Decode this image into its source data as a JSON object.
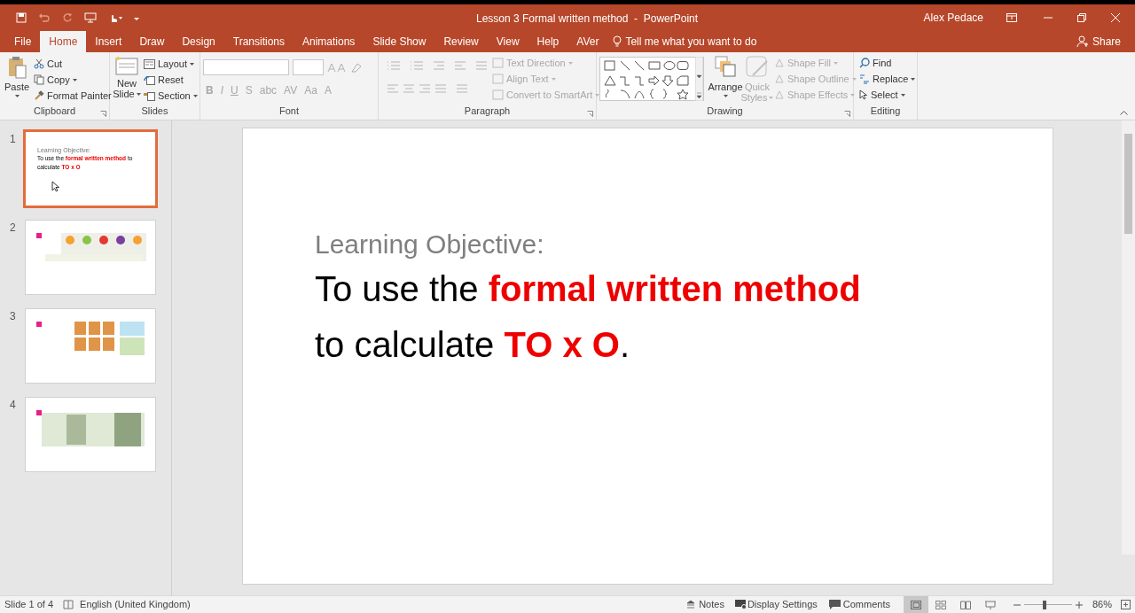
{
  "window": {
    "title": "Lesson 3 Formal written method  -  PowerPoint",
    "user": "Alex Pedace"
  },
  "tabs": [
    {
      "label": "File",
      "selected": false
    },
    {
      "label": "Home",
      "selected": true
    },
    {
      "label": "Insert",
      "selected": false
    },
    {
      "label": "Draw",
      "selected": false
    },
    {
      "label": "Design",
      "selected": false
    },
    {
      "label": "Transitions",
      "selected": false
    },
    {
      "label": "Animations",
      "selected": false
    },
    {
      "label": "Slide Show",
      "selected": false
    },
    {
      "label": "Review",
      "selected": false
    },
    {
      "label": "View",
      "selected": false
    },
    {
      "label": "Help",
      "selected": false
    },
    {
      "label": "AVer",
      "selected": false
    }
  ],
  "tell_me": {
    "placeholder": "Tell me what you want to do"
  },
  "share": "Share",
  "ribbon": {
    "clipboard": {
      "label": "Clipboard",
      "paste": "Paste",
      "cut": "Cut",
      "copy": "Copy",
      "format_painter": "Format Painter"
    },
    "slides": {
      "label": "Slides",
      "new_slide": [
        "New",
        "Slide"
      ],
      "layout": "Layout",
      "reset": "Reset",
      "section": "Section"
    },
    "font": {
      "label": "Font",
      "buttons": [
        {
          "text": "B",
          "disabled": true
        },
        {
          "text": "I",
          "disabled": true
        },
        {
          "text": "U",
          "disabled": true
        },
        {
          "text": "S",
          "disabled": true
        },
        {
          "text": "abc",
          "disabled": true
        },
        {
          "text": "AV",
          "disabled": true
        },
        {
          "text": "Aa",
          "disabled": true
        },
        {
          "text": "A",
          "disabled": true
        }
      ]
    },
    "paragraph": {
      "label": "Paragraph",
      "items": [
        {
          "label": "Text Direction",
          "disabled": true
        },
        {
          "label": "Align Text",
          "disabled": true
        },
        {
          "label": "Convert to SmartArt",
          "disabled": true
        }
      ]
    },
    "drawing": {
      "label": "Drawing",
      "arrange": "Arrange",
      "quick_styles": [
        "Quick",
        "Styles"
      ],
      "quick_styles_disabled": true,
      "items": [
        {
          "label": "Shape Fill",
          "disabled": true
        },
        {
          "label": "Shape Outline",
          "disabled": true
        },
        {
          "label": "Shape Effects",
          "disabled": true
        }
      ]
    },
    "editing": {
      "label": "Editing",
      "find": "Find",
      "replace": "Replace",
      "select": "Select"
    }
  },
  "thumbnails": [
    {
      "number": "1",
      "selected": true,
      "kind": "title",
      "heading": "Learning Objective:",
      "body": "To use the **formal written method** to calculate **TO x O**"
    },
    {
      "number": "2",
      "selected": false,
      "kind": "picture"
    },
    {
      "number": "3",
      "selected": false,
      "kind": "picture"
    },
    {
      "number": "4",
      "selected": false,
      "kind": "picture"
    }
  ],
  "slide": {
    "heading": "Learning Objective:",
    "body": "To use the **formal written method** to calculate **TO x O**."
  },
  "status_bar": {
    "slide": "Slide 1 of 4",
    "language": "English (United Kingdom)",
    "notes": "Notes",
    "display_settings": "Display Settings",
    "comments": "Comments",
    "views": [
      {
        "kind": "normal",
        "selected": true
      },
      {
        "kind": "sorter",
        "selected": false
      },
      {
        "kind": "reading",
        "selected": false
      },
      {
        "kind": "show",
        "selected": false
      }
    ],
    "zoom": {
      "level": 0.42,
      "reading": "86%"
    }
  }
}
